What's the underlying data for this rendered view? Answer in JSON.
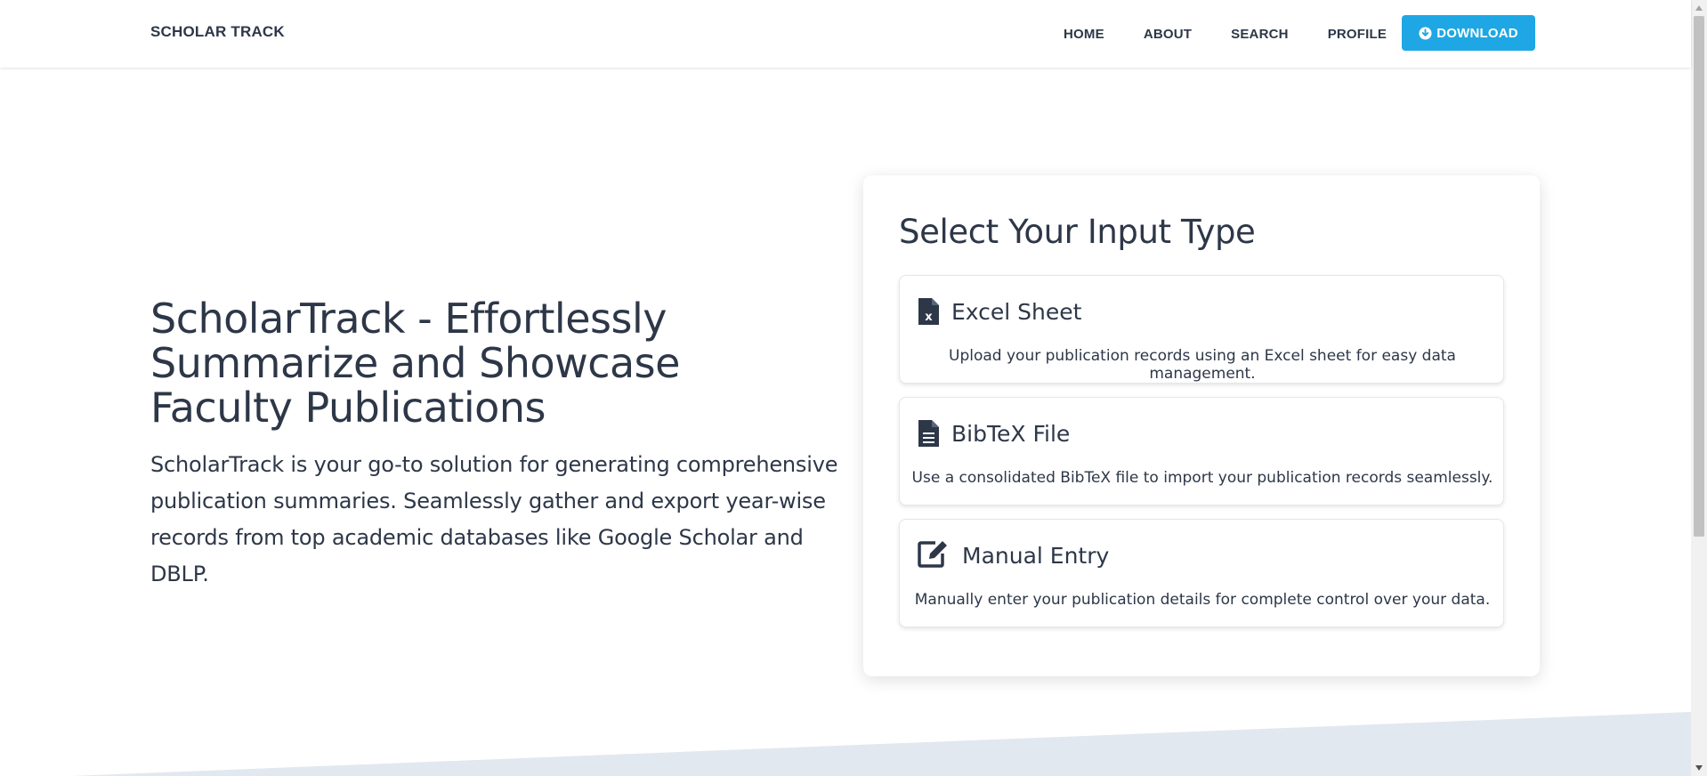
{
  "nav": {
    "brand": "SCHOLAR TRACK",
    "links": [
      "HOME",
      "ABOUT",
      "SEARCH",
      "PROFILE"
    ],
    "download_label": "DOWNLOAD",
    "download_color": "#1ea7e4"
  },
  "hero": {
    "title": "ScholarTrack - Effortlessly Summarize and Showcase Faculty Publications",
    "description": "ScholarTrack is your go-to solution for generating comprehensive publication summaries. Seamlessly gather and export year-wise records from top academic databases like Google Scholar and DBLP."
  },
  "input_card": {
    "title": "Select Your Input Type",
    "options": [
      {
        "icon": "excel-file-icon",
        "title": "Excel Sheet",
        "description": "Upload your publication records using an Excel sheet for easy data management."
      },
      {
        "icon": "text-file-icon",
        "title": "BibTeX File",
        "description": "Use a consolidated BibTeX file to import your publication records seamlessly."
      },
      {
        "icon": "edit-icon",
        "title": "Manual Entry",
        "description": "Manually enter your publication details for complete control over your data."
      }
    ]
  },
  "colors": {
    "text": "#2d3748",
    "accent": "#1ea7e4",
    "band": "#e2e8f0"
  }
}
